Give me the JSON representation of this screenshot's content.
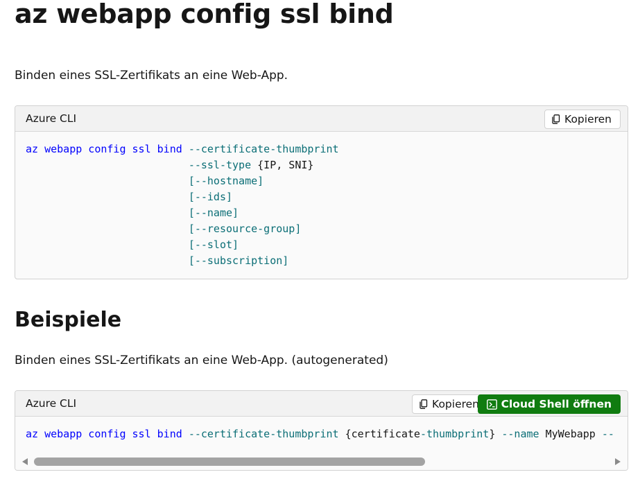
{
  "page": {
    "title": "az webapp config ssl bind",
    "description": "Binden eines SSL-Zertifikats an eine Web-App."
  },
  "syntax_block": {
    "language": "Azure CLI",
    "copy_label": "Kopieren",
    "lines": [
      {
        "indent": "",
        "parts": [
          {
            "t": "az webapp config ssl bind",
            "c": "kw"
          },
          {
            "t": " ",
            "c": "pl"
          },
          {
            "t": "--certificate-thumbprint",
            "c": "pm"
          }
        ]
      },
      {
        "indent": "                          ",
        "parts": [
          {
            "t": "--ssl-type",
            "c": "pm"
          },
          {
            "t": " {IP, SNI}",
            "c": "pl"
          }
        ]
      },
      {
        "indent": "                          ",
        "parts": [
          {
            "t": "[--hostname]",
            "c": "pm"
          }
        ]
      },
      {
        "indent": "                          ",
        "parts": [
          {
            "t": "[--ids]",
            "c": "pm"
          }
        ]
      },
      {
        "indent": "                          ",
        "parts": [
          {
            "t": "[--name]",
            "c": "pm"
          }
        ]
      },
      {
        "indent": "                          ",
        "parts": [
          {
            "t": "[--resource-group]",
            "c": "pm"
          }
        ]
      },
      {
        "indent": "                          ",
        "parts": [
          {
            "t": "[--slot]",
            "c": "pm"
          }
        ]
      },
      {
        "indent": "                          ",
        "parts": [
          {
            "t": "[--subscription]",
            "c": "pm"
          }
        ]
      }
    ]
  },
  "examples": {
    "heading": "Beispiele",
    "description": "Binden eines SSL-Zertifikats an eine Web-App. (autogenerated)",
    "block": {
      "language": "Azure CLI",
      "copy_label": "Kopieren",
      "cloud_shell_label": "Cloud Shell öffnen",
      "lines": [
        {
          "indent": "",
          "parts": [
            {
              "t": "az webapp config ssl bind",
              "c": "kw"
            },
            {
              "t": " ",
              "c": "pl"
            },
            {
              "t": "--certificate-thumbprint",
              "c": "pm"
            },
            {
              "t": " {certificate",
              "c": "pl"
            },
            {
              "t": "-thumbprint",
              "c": "pm"
            },
            {
              "t": "} ",
              "c": "pl"
            },
            {
              "t": "--name",
              "c": "pm"
            },
            {
              "t": " MyWebapp ",
              "c": "pl"
            },
            {
              "t": "--",
              "c": "pm"
            }
          ]
        }
      ]
    }
  },
  "icons": {
    "copy": "copy-icon",
    "cloud_shell": "terminal-icon",
    "scroll_left": "scroll-left-arrow",
    "scroll_right": "scroll-right-arrow"
  },
  "colors": {
    "keyword": "#0101fd",
    "parameter": "#0b6e76",
    "primary_button": "#107c10"
  }
}
